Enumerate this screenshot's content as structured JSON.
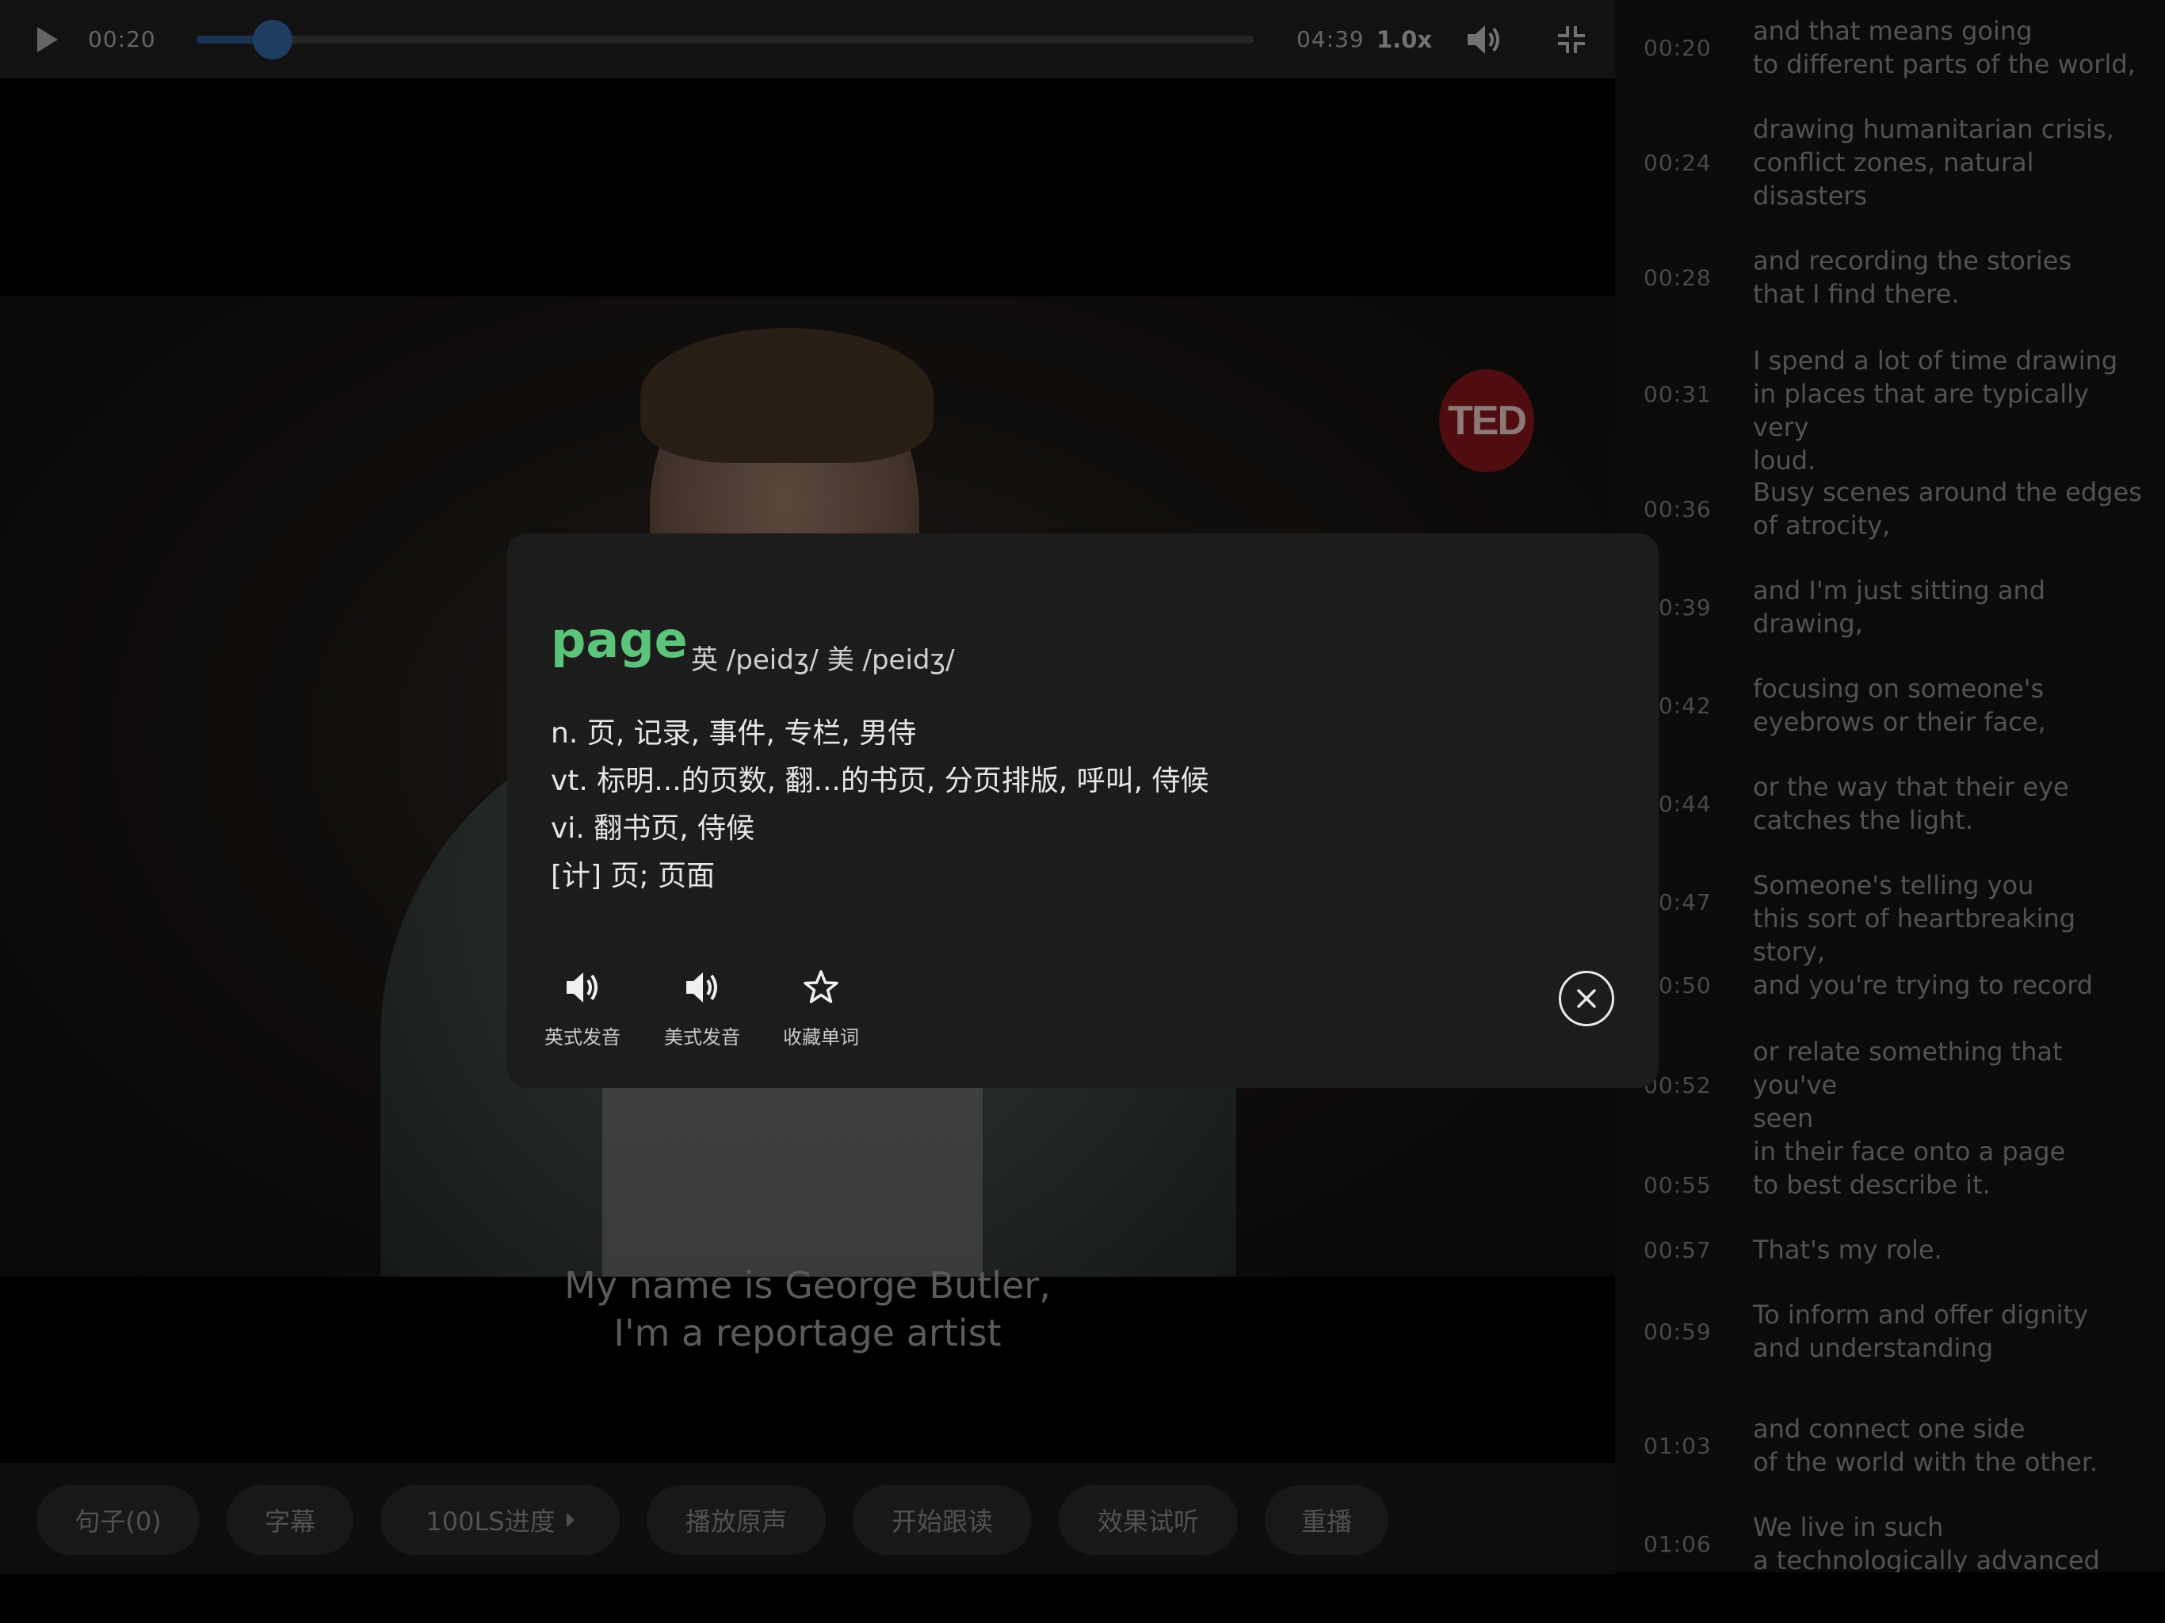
{
  "player": {
    "time_current": "00:20",
    "time_total": "04:39",
    "speed": "1.0x",
    "progress_fraction": 0.072,
    "play_icon": "play-icon",
    "volume_icon": "volume-icon",
    "fullscreen_icon": "exit-fullscreen-icon",
    "ted_logo": "TED",
    "accent_color": "#2e5f95"
  },
  "subtitle": {
    "line1": "My name is George Butler,",
    "line2": "I'm a reportage artist"
  },
  "bottom_bar": {
    "buttons": [
      "句子(0)",
      "字幕",
      "100LS进度",
      "播放原声",
      "开始跟读",
      "效果试听",
      "重播"
    ]
  },
  "transcript": [
    {
      "time": "00:20",
      "text": "and that means going\nto different parts of the world,"
    },
    {
      "time": "00:24",
      "text": "drawing humanitarian crisis,\nconflict zones, natural\ndisasters"
    },
    {
      "time": "00:28",
      "text": "and recording the stories\nthat I find there."
    },
    {
      "time": "00:31",
      "text": "I spend a lot of time drawing\nin places that are typically very\nloud."
    },
    {
      "time": "00:36",
      "text": "Busy scenes around the edges\nof atrocity,"
    },
    {
      "time": "00:39",
      "text": "and I'm just sitting and\ndrawing,"
    },
    {
      "time": "00:42",
      "text": "focusing on someone's\neyebrows or their face,"
    },
    {
      "time": "00:44",
      "text": "or the way that their eye\ncatches the light."
    },
    {
      "time": "00:47",
      "text": "Someone's telling you\nthis sort of heartbreaking story,"
    },
    {
      "time": "00:50",
      "text": "and you're trying to record"
    },
    {
      "time": "00:52",
      "text": "or relate something that you've\nseen\nin their face onto a page"
    },
    {
      "time": "00:55",
      "text": "to best describe it."
    },
    {
      "time": "00:57",
      "text": "That's my role."
    },
    {
      "time": "00:59",
      "text": "To inform and offer dignity\nand understanding"
    },
    {
      "time": "01:03",
      "text": "and connect one side\nof the world with the other."
    },
    {
      "time": "01:06",
      "text": "We live in such\na technologically advanced age"
    }
  ],
  "dictionary": {
    "word": "page",
    "phonetics": "英 /peidʒ/  美 /peidʒ/",
    "definitions": [
      "n. 页, 记录, 事件, 专栏, 男侍",
      "vt. 标明...的页数, 翻...的书页, 分页排版, 呼叫, 侍候",
      "vi. 翻书页, 侍候",
      "[计] 页; 页面"
    ],
    "actions": [
      {
        "label": "英式发音",
        "icon": "speaker-icon"
      },
      {
        "label": "美式发音",
        "icon": "speaker-icon"
      },
      {
        "label": "收藏单词",
        "icon": "star-icon"
      }
    ],
    "close_icon": "close-icon",
    "word_color": "#5bc47a"
  }
}
